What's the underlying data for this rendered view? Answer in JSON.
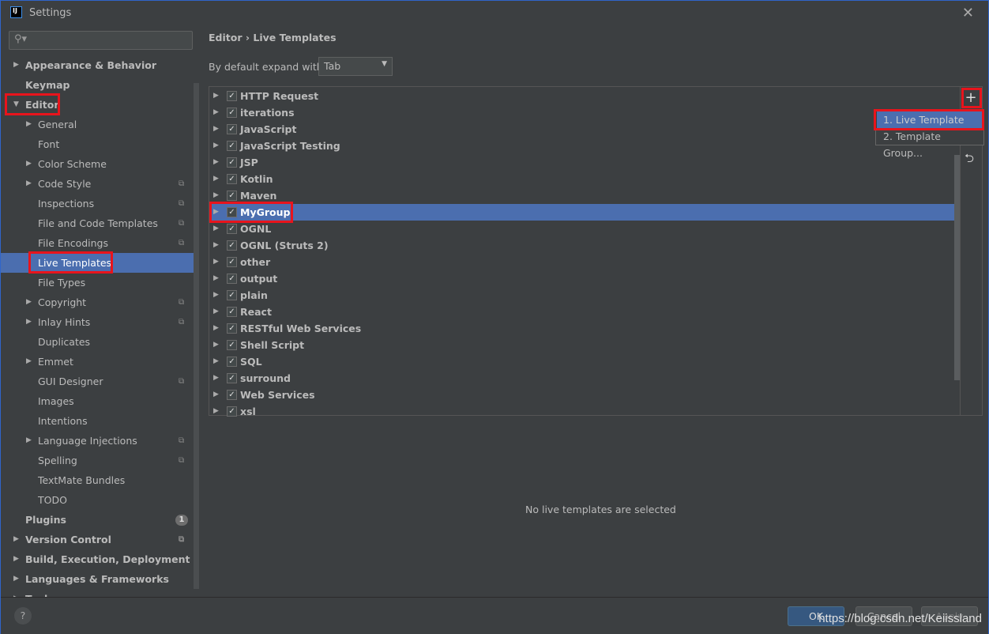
{
  "window": {
    "title": "Settings",
    "logo": "IJ"
  },
  "sidebar": {
    "search_icon": "search-icon",
    "items": [
      {
        "label": "Appearance & Behavior",
        "level": 0,
        "arrow": "right",
        "bold": true
      },
      {
        "label": "Keymap",
        "level": 0,
        "bold": true
      },
      {
        "label": "Editor",
        "level": 0,
        "arrow": "down",
        "bold": true,
        "highlight": true
      },
      {
        "label": "General",
        "level": 1,
        "arrow": "right"
      },
      {
        "label": "Font",
        "level": 1
      },
      {
        "label": "Color Scheme",
        "level": 1,
        "arrow": "right"
      },
      {
        "label": "Code Style",
        "level": 1,
        "arrow": "right",
        "copy": true
      },
      {
        "label": "Inspections",
        "level": 1,
        "copy": true
      },
      {
        "label": "File and Code Templates",
        "level": 1,
        "copy": true
      },
      {
        "label": "File Encodings",
        "level": 1,
        "copy": true
      },
      {
        "label": "Live Templates",
        "level": 1,
        "selected": true,
        "highlight": true
      },
      {
        "label": "File Types",
        "level": 1
      },
      {
        "label": "Copyright",
        "level": 1,
        "arrow": "right",
        "copy": true
      },
      {
        "label": "Inlay Hints",
        "level": 1,
        "arrow": "right",
        "copy": true
      },
      {
        "label": "Duplicates",
        "level": 1
      },
      {
        "label": "Emmet",
        "level": 1,
        "arrow": "right"
      },
      {
        "label": "GUI Designer",
        "level": 1,
        "copy": true
      },
      {
        "label": "Images",
        "level": 1
      },
      {
        "label": "Intentions",
        "level": 1
      },
      {
        "label": "Language Injections",
        "level": 1,
        "arrow": "right",
        "copy": true
      },
      {
        "label": "Spelling",
        "level": 1,
        "copy": true
      },
      {
        "label": "TextMate Bundles",
        "level": 1
      },
      {
        "label": "TODO",
        "level": 1
      },
      {
        "label": "Plugins",
        "level": 0,
        "bold": true,
        "badge": "1"
      },
      {
        "label": "Version Control",
        "level": 0,
        "arrow": "right",
        "bold": true,
        "copy": true
      },
      {
        "label": "Build, Execution, Deployment",
        "level": 0,
        "arrow": "right",
        "bold": true
      },
      {
        "label": "Languages & Frameworks",
        "level": 0,
        "arrow": "right",
        "bold": true
      },
      {
        "label": "Tools",
        "level": 0,
        "arrow": "right",
        "bold": true
      }
    ]
  },
  "main": {
    "breadcrumb": "Editor  ›  Live Templates",
    "expand_label": "By default expand with",
    "expand_value": "Tab",
    "groups": [
      {
        "label": "HTTP Request",
        "checked": true
      },
      {
        "label": "iterations",
        "checked": true
      },
      {
        "label": "JavaScript",
        "checked": true
      },
      {
        "label": "JavaScript Testing",
        "checked": true
      },
      {
        "label": "JSP",
        "checked": true
      },
      {
        "label": "Kotlin",
        "checked": true
      },
      {
        "label": "Maven",
        "checked": true
      },
      {
        "label": "MyGroup",
        "checked": true,
        "selected": true,
        "highlight": true
      },
      {
        "label": "OGNL",
        "checked": true
      },
      {
        "label": "OGNL (Struts 2)",
        "checked": true
      },
      {
        "label": "other",
        "checked": true
      },
      {
        "label": "output",
        "checked": true
      },
      {
        "label": "plain",
        "checked": true
      },
      {
        "label": "React",
        "checked": true
      },
      {
        "label": "RESTful Web Services",
        "checked": true
      },
      {
        "label": "Shell Script",
        "checked": true
      },
      {
        "label": "SQL",
        "checked": true
      },
      {
        "label": "surround",
        "checked": true
      },
      {
        "label": "Web Services",
        "checked": true
      },
      {
        "label": "xsl",
        "checked": true
      }
    ],
    "add_icon": "+",
    "undo_icon": "⮌",
    "popup": [
      "1. Live Template",
      "2. Template Group..."
    ],
    "empty_message": "No live templates are selected"
  },
  "footer": {
    "help": "?",
    "ok": "OK",
    "cancel": "Cancel",
    "apply": "Apply",
    "watermark": "https://blog.csdn.net/Keiissland"
  },
  "colors": {
    "selection": "#4b6eaf",
    "highlight": "#e8141c",
    "background": "#3c3f41"
  }
}
